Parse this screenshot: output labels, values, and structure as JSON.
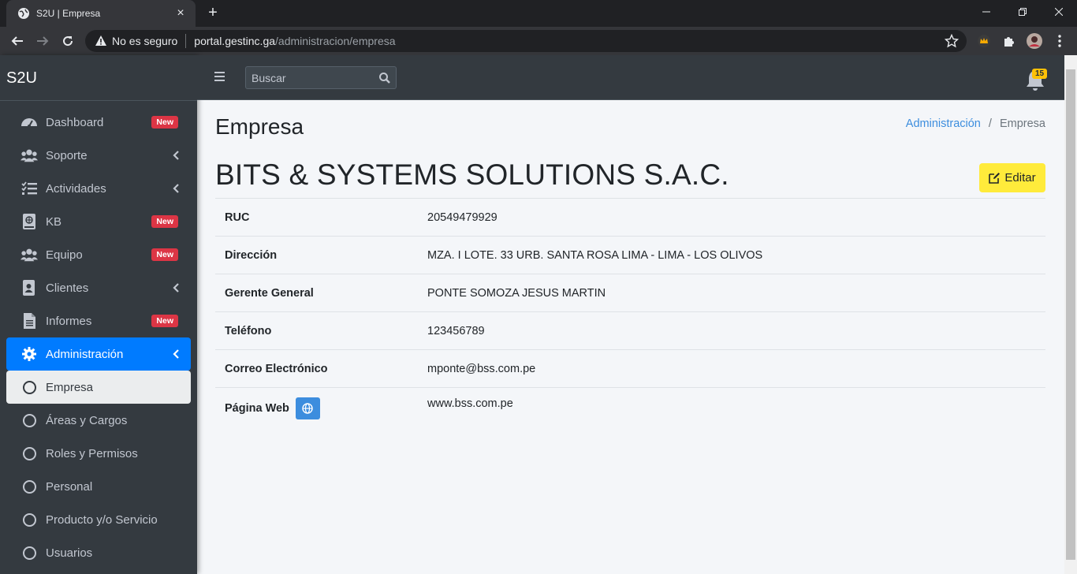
{
  "browser": {
    "tab_title": "S2U | Empresa",
    "insecure_label": "No es seguro",
    "url_host": "portal.gestinc.ga",
    "url_path": "/administracion/empresa"
  },
  "sidebar": {
    "brand": "S2U",
    "items": [
      {
        "label": "Dashboard",
        "icon": "tachometer-icon",
        "badge": "New"
      },
      {
        "label": "Soporte",
        "icon": "users-icon",
        "chevron": true
      },
      {
        "label": "Actividades",
        "icon": "tasks-icon",
        "chevron": true
      },
      {
        "label": "KB",
        "icon": "book-icon",
        "badge": "New"
      },
      {
        "label": "Equipo",
        "icon": "users-icon",
        "badge": "New"
      },
      {
        "label": "Clientes",
        "icon": "address-book-icon",
        "chevron": true
      },
      {
        "label": "Informes",
        "icon": "file-icon",
        "badge": "New"
      },
      {
        "label": "Administración",
        "icon": "gear-icon",
        "chevron": true,
        "active": true
      }
    ],
    "subitems": [
      {
        "label": "Empresa",
        "active": true
      },
      {
        "label": "Áreas y Cargos"
      },
      {
        "label": "Roles y Permisos"
      },
      {
        "label": "Personal"
      },
      {
        "label": "Producto y/o Servicio"
      },
      {
        "label": "Usuarios"
      }
    ]
  },
  "navbar": {
    "search_placeholder": "Buscar",
    "notifications_count": "15"
  },
  "page": {
    "title": "Empresa",
    "breadcrumb": {
      "parent": "Administración",
      "separator": "/",
      "current": "Empresa"
    },
    "company_name": "BITS & SYSTEMS SOLUTIONS S.A.C.",
    "edit_label": "Editar",
    "fields": [
      {
        "key": "RUC",
        "value": "20549479929"
      },
      {
        "key": "Dirección",
        "value": "MZA. I LOTE. 33 URB. SANTA ROSA LIMA - LIMA - LOS OLIVOS"
      },
      {
        "key": "Gerente General",
        "value": "PONTE SOMOZA JESUS MARTIN"
      },
      {
        "key": "Teléfono",
        "value": "123456789"
      },
      {
        "key": "Correo Electrónico",
        "value": "mponte@bss.com.pe"
      },
      {
        "key": "Página Web",
        "value": "www.bss.com.pe"
      }
    ]
  },
  "colors": {
    "sidebar_bg": "#343a40",
    "active_blue": "#007bff",
    "badge_red": "#dc3545",
    "edit_yellow": "#ffeb3b",
    "link_blue": "#3c8dde"
  }
}
